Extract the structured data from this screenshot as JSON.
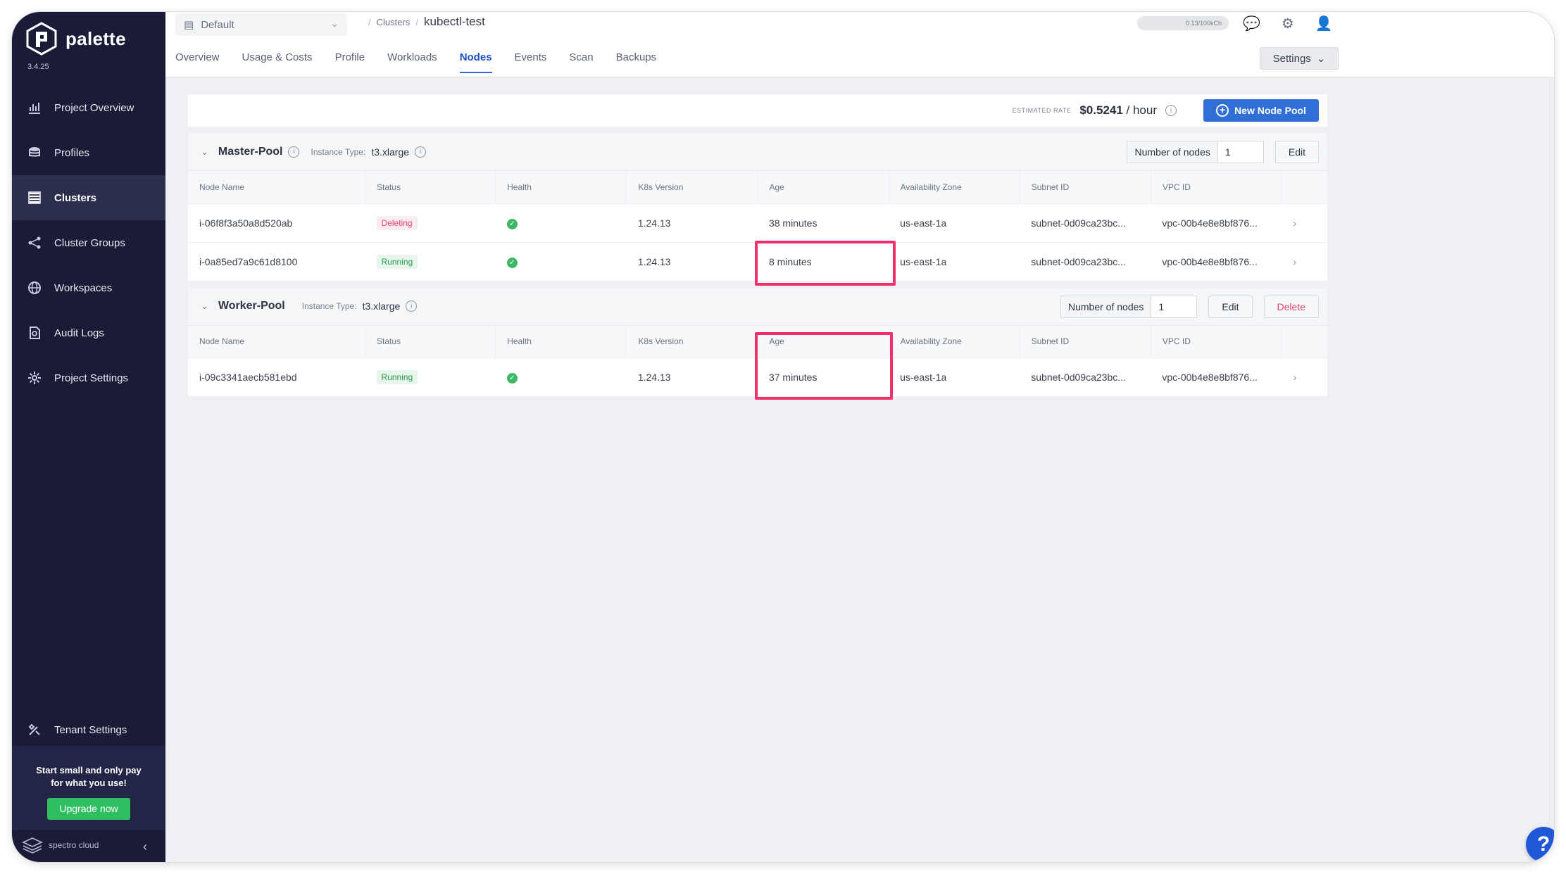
{
  "app": {
    "name": "palette",
    "version": "3.4.25"
  },
  "sidebar": {
    "items": [
      {
        "label": "Project Overview",
        "icon": "chart-icon"
      },
      {
        "label": "Profiles",
        "icon": "layers-icon"
      },
      {
        "label": "Clusters",
        "icon": "clusters-icon",
        "active": true
      },
      {
        "label": "Cluster Groups",
        "icon": "network-icon"
      },
      {
        "label": "Workspaces",
        "icon": "globe-icon"
      },
      {
        "label": "Audit Logs",
        "icon": "document-icon"
      },
      {
        "label": "Project Settings",
        "icon": "gear-icon"
      }
    ],
    "tenant_settings": "Tenant Settings",
    "promo_line1": "Start small and only pay",
    "promo_line2": "for what you use!",
    "upgrade_label": "Upgrade now",
    "brand": "spectro cloud",
    "collapse": "‹"
  },
  "header": {
    "project": "Default",
    "breadcrumb_parent": "Clusters",
    "breadcrumb_current": "kubectl-test",
    "usage": "0.13/100kCh",
    "tabs": [
      "Overview",
      "Usage & Costs",
      "Profile",
      "Workloads",
      "Nodes",
      "Events",
      "Scan",
      "Backups"
    ],
    "active_tab": "Nodes",
    "settings_label": "Settings"
  },
  "rate": {
    "label": "ESTIMATED RATE",
    "value": "$0.5241",
    "unit": " / hour",
    "new_pool_label": "New Node Pool"
  },
  "columns": [
    "Node Name",
    "Status",
    "Health",
    "K8s Version",
    "Age",
    "Availability Zone",
    "Subnet ID",
    "VPC ID"
  ],
  "pools": [
    {
      "name": "Master-Pool",
      "instance_label": "Instance Type:",
      "instance_type": "t3.xlarge",
      "nodes_label": "Number of nodes",
      "nodes_count": "1",
      "edit_label": "Edit",
      "rows": [
        {
          "name": "i-06f8f3a50a8d520ab",
          "status": "Deleting",
          "version": "1.24.13",
          "age": "38 minutes",
          "zone": "us-east-1a",
          "subnet": "subnet-0d09ca23bc...",
          "vpc": "vpc-00b4e8e8bf876..."
        },
        {
          "name": "i-0a85ed7a9c61d8100",
          "status": "Running",
          "version": "1.24.13",
          "age": "8 minutes",
          "zone": "us-east-1a",
          "subnet": "subnet-0d09ca23bc...",
          "vpc": "vpc-00b4e8e8bf876..."
        }
      ]
    },
    {
      "name": "Worker-Pool",
      "instance_label": "Instance Type:",
      "instance_type": "t3.xlarge",
      "nodes_label": "Number of nodes",
      "nodes_count": "1",
      "edit_label": "Edit",
      "delete_label": "Delete",
      "rows": [
        {
          "name": "i-09c3341aecb581ebd",
          "status": "Running",
          "version": "1.24.13",
          "age": "37 minutes",
          "zone": "us-east-1a",
          "subnet": "subnet-0d09ca23bc...",
          "vpc": "vpc-00b4e8e8bf876..."
        }
      ]
    }
  ],
  "help_label": "?",
  "colors": {
    "sidebar": "#1a1b36",
    "accent": "#2f6fd6",
    "highlight": "#f0306a"
  }
}
